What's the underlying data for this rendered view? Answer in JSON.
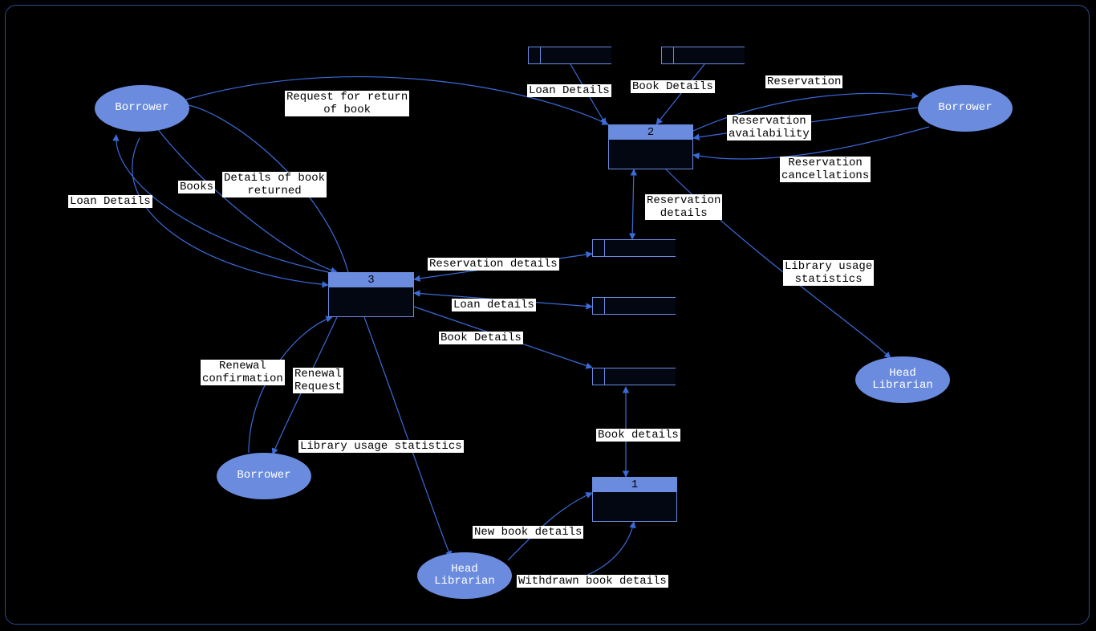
{
  "entities": {
    "borrower_top_left": "Borrower",
    "borrower_bottom_left": "Borrower",
    "borrower_right": "Borrower",
    "head_librarian_bottom": "Head\nLibrarian",
    "head_librarian_right": "Head\nLibrarian"
  },
  "processes": {
    "p1": "1",
    "p2": "2",
    "p3": "3"
  },
  "labels": {
    "request_return": "Request for return\nof book",
    "loan_details_left": "Loan Details",
    "books": "Books",
    "details_returned": "Details of book\nreturned",
    "renewal_confirmation": "Renewal\nconfirmation",
    "renewal_request": "Renewal\nRequest",
    "library_usage_left": "Library usage statistics",
    "reservation_details_mid": "Reservation details",
    "loan_details_mid": "Loan details",
    "book_details_mid": "Book Details",
    "loan_details_top": "Loan Details",
    "book_details_top": "Book Details",
    "reservation": "Reservation",
    "reservation_availability": "Reservation\navailability",
    "reservation_cancellations": "Reservation\ncancellations",
    "reservation_details_vert": "Reservation\ndetails",
    "library_usage_right": "Library usage\nstatistics",
    "book_details_vert": "Book details",
    "new_book_details": "New book details",
    "withdrawn_book_details": "Withdrawn book details"
  }
}
